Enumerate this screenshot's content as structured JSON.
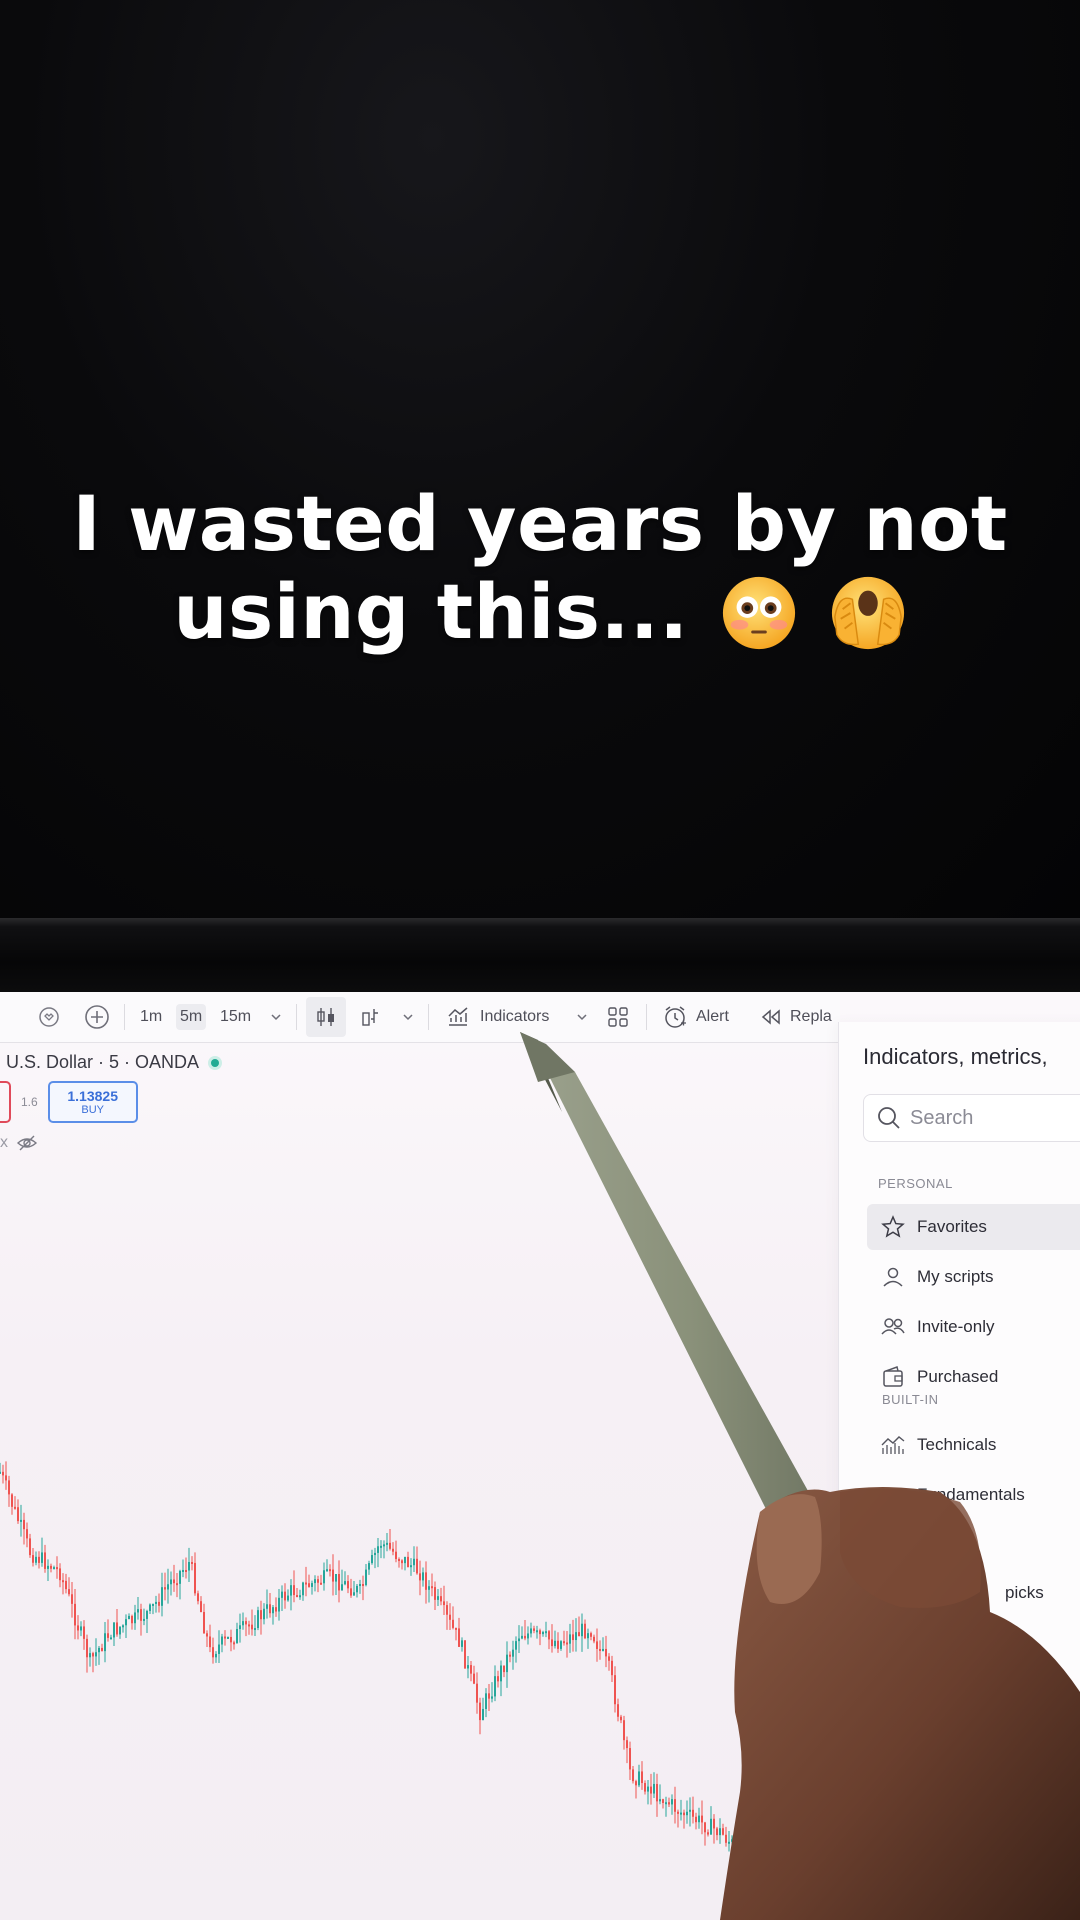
{
  "caption": {
    "line1": "I wasted years by not",
    "line2": "using this..."
  },
  "toolbar": {
    "intervals": [
      "1m",
      "5m",
      "15m"
    ],
    "selected_interval": "5m",
    "indicators_label": "Indicators",
    "alert_label": "Alert",
    "replay_label": "Repla"
  },
  "symbol": {
    "title": "U.S. Dollar · 5 · OANDA",
    "spread": "1.6",
    "buy_price": "1.13825",
    "buy_label": "BUY",
    "row3_prefix": "x"
  },
  "panel": {
    "title": "Indicators, metrics,",
    "search_placeholder": "Search",
    "personal_section": "PERSONAL",
    "builtin_section": "BUILT-IN",
    "items": [
      {
        "label": "Favorites",
        "icon": "star-icon"
      },
      {
        "label": "My scripts",
        "icon": "user-icon"
      },
      {
        "label": "Invite-only",
        "icon": "users-icon"
      },
      {
        "label": "Purchased",
        "icon": "wallet-icon"
      },
      {
        "label": "Technicals",
        "icon": "technicals-icon"
      },
      {
        "label": "Fundamentals",
        "icon": "fundamentals-icon"
      },
      {
        "label": "picks",
        "icon": "picks-icon"
      }
    ]
  },
  "colors": {
    "up": "#26a69a",
    "down": "#ef5350",
    "live": "#22ab94",
    "accent": "#2962ff"
  }
}
